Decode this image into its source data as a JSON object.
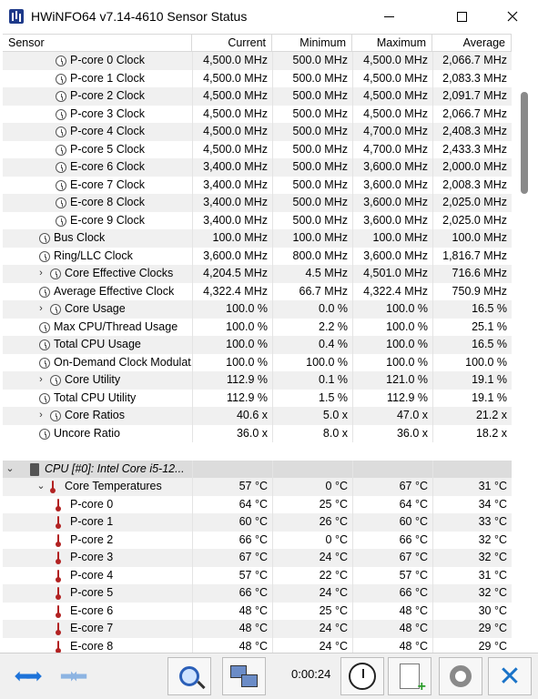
{
  "window": {
    "title": "HWiNFO64 v7.14-4610 Sensor Status"
  },
  "columns": {
    "sensor": "Sensor",
    "current": "Current",
    "minimum": "Minimum",
    "maximum": "Maximum",
    "average": "Average"
  },
  "rows": [
    {
      "indent": 2,
      "icon": "clock-icon",
      "chev": "",
      "name": "P-core 0 Clock",
      "cur": "4,500.0 MHz",
      "min": "500.0 MHz",
      "max": "4,500.0 MHz",
      "avg": "2,066.7 MHz"
    },
    {
      "indent": 2,
      "icon": "clock-icon",
      "chev": "",
      "name": "P-core 1 Clock",
      "cur": "4,500.0 MHz",
      "min": "500.0 MHz",
      "max": "4,500.0 MHz",
      "avg": "2,083.3 MHz"
    },
    {
      "indent": 2,
      "icon": "clock-icon",
      "chev": "",
      "name": "P-core 2 Clock",
      "cur": "4,500.0 MHz",
      "min": "500.0 MHz",
      "max": "4,500.0 MHz",
      "avg": "2,091.7 MHz"
    },
    {
      "indent": 2,
      "icon": "clock-icon",
      "chev": "",
      "name": "P-core 3 Clock",
      "cur": "4,500.0 MHz",
      "min": "500.0 MHz",
      "max": "4,500.0 MHz",
      "avg": "2,066.7 MHz"
    },
    {
      "indent": 2,
      "icon": "clock-icon",
      "chev": "",
      "name": "P-core 4 Clock",
      "cur": "4,500.0 MHz",
      "min": "500.0 MHz",
      "max": "4,700.0 MHz",
      "avg": "2,408.3 MHz"
    },
    {
      "indent": 2,
      "icon": "clock-icon",
      "chev": "",
      "name": "P-core 5 Clock",
      "cur": "4,500.0 MHz",
      "min": "500.0 MHz",
      "max": "4,700.0 MHz",
      "avg": "2,433.3 MHz"
    },
    {
      "indent": 2,
      "icon": "clock-icon",
      "chev": "",
      "name": "E-core 6 Clock",
      "cur": "3,400.0 MHz",
      "min": "500.0 MHz",
      "max": "3,600.0 MHz",
      "avg": "2,000.0 MHz"
    },
    {
      "indent": 2,
      "icon": "clock-icon",
      "chev": "",
      "name": "E-core 7 Clock",
      "cur": "3,400.0 MHz",
      "min": "500.0 MHz",
      "max": "3,600.0 MHz",
      "avg": "2,008.3 MHz"
    },
    {
      "indent": 2,
      "icon": "clock-icon",
      "chev": "",
      "name": "E-core 8 Clock",
      "cur": "3,400.0 MHz",
      "min": "500.0 MHz",
      "max": "3,600.0 MHz",
      "avg": "2,025.0 MHz"
    },
    {
      "indent": 2,
      "icon": "clock-icon",
      "chev": "",
      "name": "E-core 9 Clock",
      "cur": "3,400.0 MHz",
      "min": "500.0 MHz",
      "max": "3,600.0 MHz",
      "avg": "2,025.0 MHz"
    },
    {
      "indent": 1,
      "icon": "clock-icon",
      "chev": "",
      "name": "Bus Clock",
      "cur": "100.0 MHz",
      "min": "100.0 MHz",
      "max": "100.0 MHz",
      "avg": "100.0 MHz"
    },
    {
      "indent": 1,
      "icon": "clock-icon",
      "chev": "",
      "name": "Ring/LLC Clock",
      "cur": "3,600.0 MHz",
      "min": "800.0 MHz",
      "max": "3,600.0 MHz",
      "avg": "1,816.7 MHz"
    },
    {
      "indent": 1,
      "icon": "clock-icon",
      "chev": ">",
      "name": "Core Effective Clocks",
      "cur": "4,204.5 MHz",
      "min": "4.5 MHz",
      "max": "4,501.0 MHz",
      "avg": "716.6 MHz"
    },
    {
      "indent": 1,
      "icon": "clock-icon",
      "chev": "",
      "name": "Average Effective Clock",
      "cur": "4,322.4 MHz",
      "min": "66.7 MHz",
      "max": "4,322.4 MHz",
      "avg": "750.9 MHz"
    },
    {
      "indent": 1,
      "icon": "clock-icon",
      "chev": ">",
      "name": "Core Usage",
      "cur": "100.0 %",
      "min": "0.0 %",
      "max": "100.0 %",
      "avg": "16.5 %"
    },
    {
      "indent": 1,
      "icon": "clock-icon",
      "chev": "",
      "name": "Max CPU/Thread Usage",
      "cur": "100.0 %",
      "min": "2.2 %",
      "max": "100.0 %",
      "avg": "25.1 %"
    },
    {
      "indent": 1,
      "icon": "clock-icon",
      "chev": "",
      "name": "Total CPU Usage",
      "cur": "100.0 %",
      "min": "0.4 %",
      "max": "100.0 %",
      "avg": "16.5 %"
    },
    {
      "indent": 1,
      "icon": "clock-icon",
      "chev": "",
      "name": "On-Demand Clock Modulat...",
      "cur": "100.0 %",
      "min": "100.0 %",
      "max": "100.0 %",
      "avg": "100.0 %"
    },
    {
      "indent": 1,
      "icon": "clock-icon",
      "chev": ">",
      "name": "Core Utility",
      "cur": "112.9 %",
      "min": "0.1 %",
      "max": "121.0 %",
      "avg": "19.1 %"
    },
    {
      "indent": 1,
      "icon": "clock-icon",
      "chev": "",
      "name": "Total CPU Utility",
      "cur": "112.9 %",
      "min": "1.5 %",
      "max": "112.9 %",
      "avg": "19.1 %"
    },
    {
      "indent": 1,
      "icon": "clock-icon",
      "chev": ">",
      "name": "Core Ratios",
      "cur": "40.6 x",
      "min": "5.0 x",
      "max": "47.0 x",
      "avg": "21.2 x"
    },
    {
      "indent": 1,
      "icon": "clock-icon",
      "chev": "",
      "name": "Uncore Ratio",
      "cur": "36.0 x",
      "min": "8.0 x",
      "max": "36.0 x",
      "avg": "18.2 x"
    },
    {
      "spacer": true
    },
    {
      "group": true,
      "indent": 0,
      "icon": "chip-icon",
      "chev": "v",
      "name": "CPU [#0]: Intel Core i5-12...",
      "cur": "",
      "min": "",
      "max": "",
      "avg": ""
    },
    {
      "indent": 1,
      "icon": "thermometer-icon",
      "chev": "v",
      "name": "Core Temperatures",
      "cur": "57 °C",
      "min": "0 °C",
      "max": "67 °C",
      "avg": "31 °C"
    },
    {
      "indent": 2,
      "icon": "thermometer-icon",
      "chev": "",
      "name": "P-core 0",
      "cur": "64 °C",
      "min": "25 °C",
      "max": "64 °C",
      "avg": "34 °C"
    },
    {
      "indent": 2,
      "icon": "thermometer-icon",
      "chev": "",
      "name": "P-core 1",
      "cur": "60 °C",
      "min": "26 °C",
      "max": "60 °C",
      "avg": "33 °C"
    },
    {
      "indent": 2,
      "icon": "thermometer-icon",
      "chev": "",
      "name": "P-core 2",
      "cur": "66 °C",
      "min": "0 °C",
      "max": "66 °C",
      "avg": "32 °C"
    },
    {
      "indent": 2,
      "icon": "thermometer-icon",
      "chev": "",
      "name": "P-core 3",
      "cur": "67 °C",
      "min": "24 °C",
      "max": "67 °C",
      "avg": "32 °C"
    },
    {
      "indent": 2,
      "icon": "thermometer-icon",
      "chev": "",
      "name": "P-core 4",
      "cur": "57 °C",
      "min": "22 °C",
      "max": "57 °C",
      "avg": "31 °C"
    },
    {
      "indent": 2,
      "icon": "thermometer-icon",
      "chev": "",
      "name": "P-core 5",
      "cur": "66 °C",
      "min": "24 °C",
      "max": "66 °C",
      "avg": "32 °C"
    },
    {
      "indent": 2,
      "icon": "thermometer-icon",
      "chev": "",
      "name": "E-core 6",
      "cur": "48 °C",
      "min": "25 °C",
      "max": "48 °C",
      "avg": "30 °C"
    },
    {
      "indent": 2,
      "icon": "thermometer-icon",
      "chev": "",
      "name": "E-core 7",
      "cur": "48 °C",
      "min": "24 °C",
      "max": "48 °C",
      "avg": "29 °C"
    },
    {
      "indent": 2,
      "icon": "thermometer-icon",
      "chev": "",
      "name": "E-core 8",
      "cur": "48 °C",
      "min": "24 °C",
      "max": "48 °C",
      "avg": "29 °C"
    }
  ],
  "toolbar": {
    "timer": "0:00:24",
    "buttons": [
      "arrows-left-right-icon",
      "arrows-collapse-icon",
      "search-sensor-icon",
      "network-icon",
      "clock-icon",
      "report-add-icon",
      "gear-icon",
      "close-x-icon"
    ]
  },
  "colors": {
    "accent_blue": "#1a73c8",
    "row_alt": "#f0f0f0",
    "group_row": "#dcdcdc",
    "thermometer_red": "#b22222"
  }
}
